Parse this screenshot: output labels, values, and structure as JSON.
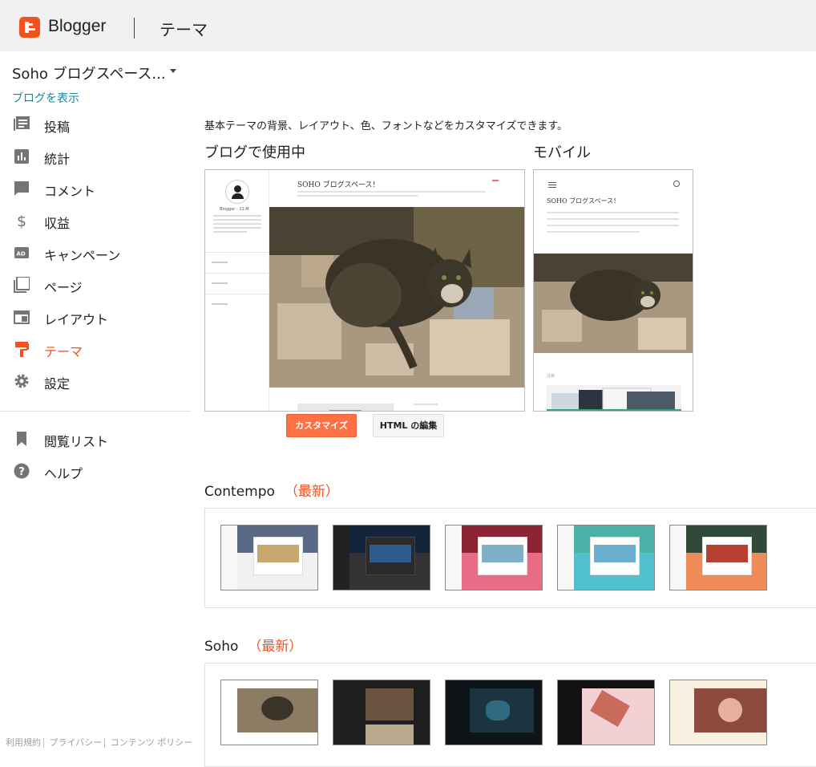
{
  "header": {
    "brand": "Blogger",
    "page_title": "テーマ"
  },
  "sidebar": {
    "blog_name": "Soho ブログスペース...",
    "view_blog": "ブログを表示",
    "items": [
      {
        "label": "投稿",
        "icon": "posts-icon"
      },
      {
        "label": "統計",
        "icon": "stats-icon"
      },
      {
        "label": "コメント",
        "icon": "comments-icon"
      },
      {
        "label": "収益",
        "icon": "earnings-icon"
      },
      {
        "label": "キャンペーン",
        "icon": "campaigns-icon"
      },
      {
        "label": "ページ",
        "icon": "pages-icon"
      },
      {
        "label": "レイアウト",
        "icon": "layout-icon"
      },
      {
        "label": "テーマ",
        "icon": "theme-icon",
        "active": true
      },
      {
        "label": "設定",
        "icon": "settings-icon"
      }
    ],
    "secondary_items": [
      {
        "label": "閲覧リスト",
        "icon": "bookmark-icon"
      },
      {
        "label": "ヘルプ",
        "icon": "help-icon"
      }
    ],
    "footer_links": [
      "利用規約",
      "プライバシー",
      "コンテンツ ポリシー"
    ]
  },
  "main": {
    "description": "基本テーマの背景、レイアウト、色、フォントなどをカスタマイズできます。",
    "in_use_label": "ブログで使用中",
    "mobile_label": "モバイル",
    "customize_button": "カスタマイズ",
    "edit_html_button": "HTML の編集",
    "desktop_preview": {
      "blog_title": "SOHO ブログスペース！",
      "profile_name": "Blogger - 11.M"
    },
    "mobile_preview": {
      "blog_title": "SOHO ブログスペース！",
      "section_label": "注目"
    },
    "theme_groups": [
      {
        "name": "Contempo",
        "badge": "（最新）"
      },
      {
        "name": "Soho",
        "badge": "（最新）"
      }
    ]
  },
  "colors": {
    "accent": "#f4511e",
    "link": "#21849b",
    "button_primary": "#ff7043"
  }
}
